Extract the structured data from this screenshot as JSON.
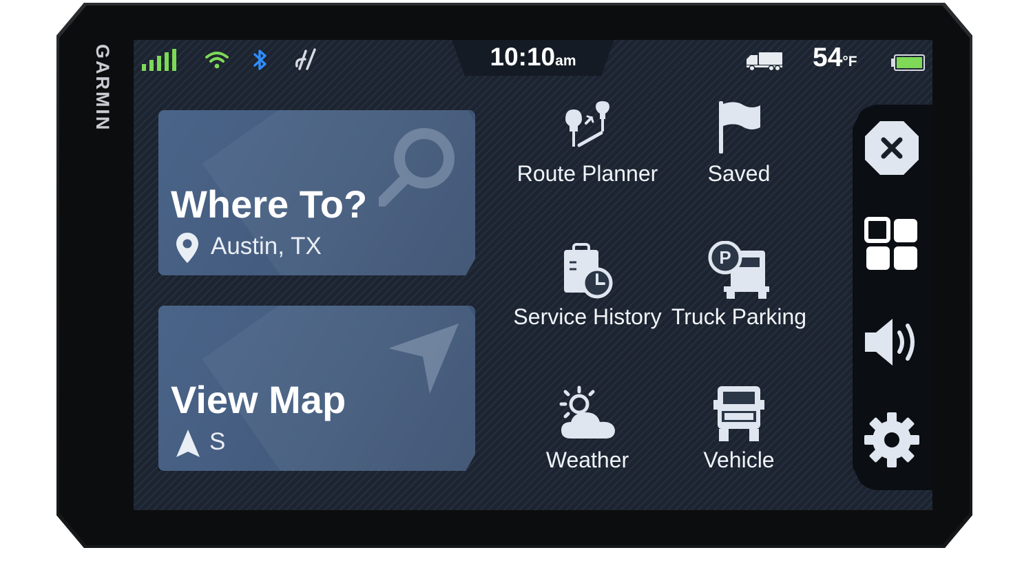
{
  "device": {
    "brand": "GARMIN"
  },
  "status_bar": {
    "clock_time": "10:10",
    "clock_ampm": "am",
    "temperature_value": "54",
    "temperature_unit": "°F",
    "icons": [
      "cell-signal-icon",
      "wifi-icon",
      "bluetooth-icon",
      "drive-app-icon",
      "truck-icon",
      "battery-icon"
    ],
    "colors": {
      "signal": "#7ed957",
      "wifi": "#7ed957",
      "bluetooth": "#2f8fff",
      "battery": "#7ed957"
    }
  },
  "cards": {
    "where_to": {
      "title": "Where To?",
      "location": "Austin, TX",
      "icons": [
        "location-pin-icon",
        "search-icon"
      ]
    },
    "view_map": {
      "title": "View Map",
      "heading": "S",
      "icons": [
        "north-arrow-icon",
        "navigation-arrow-icon"
      ]
    }
  },
  "apps": [
    {
      "label": "Route Planner",
      "icon": "route-planner-icon"
    },
    {
      "label": "Saved",
      "icon": "flag-icon"
    },
    {
      "label": "Service History",
      "icon": "service-history-icon"
    },
    {
      "label": "Truck Parking",
      "icon": "truck-parking-icon"
    },
    {
      "label": "Weather",
      "icon": "weather-icon"
    },
    {
      "label": "Vehicle",
      "icon": "vehicle-icon"
    }
  ],
  "sidebar": {
    "buttons": [
      "close-icon",
      "apps-grid-icon",
      "volume-icon",
      "settings-icon"
    ]
  }
}
